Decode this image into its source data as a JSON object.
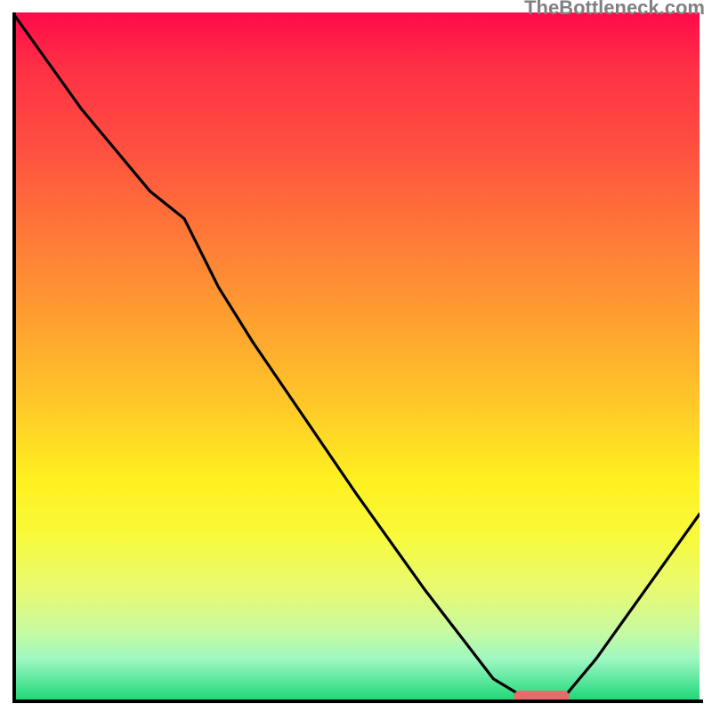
{
  "watermark": "TheBottleneck.com",
  "chart_data": {
    "type": "line",
    "x": [
      0,
      5,
      10,
      15,
      20,
      25,
      30,
      35,
      50,
      60,
      70,
      75,
      77,
      80,
      85,
      90,
      100
    ],
    "y": [
      100,
      93,
      86,
      80,
      74,
      70,
      60,
      52,
      30,
      16,
      3,
      0,
      0,
      0,
      6,
      13,
      27
    ],
    "xlabel": "",
    "ylabel": "",
    "title": "",
    "xlim": [
      0,
      100
    ],
    "ylim": [
      0,
      100
    ],
    "optimal_range": {
      "x_start": 73,
      "x_end": 81,
      "y": 0
    },
    "annotations": [],
    "gradient_stops": [
      {
        "pos": 0,
        "color": "#ff0a4a"
      },
      {
        "pos": 8,
        "color": "#ff3046"
      },
      {
        "pos": 20,
        "color": "#ff5040"
      },
      {
        "pos": 32,
        "color": "#ff7838"
      },
      {
        "pos": 45,
        "color": "#ffa030"
      },
      {
        "pos": 57,
        "color": "#ffc828"
      },
      {
        "pos": 68,
        "color": "#fff020"
      },
      {
        "pos": 76,
        "color": "#f8fa3a"
      },
      {
        "pos": 84,
        "color": "#e8fa72"
      },
      {
        "pos": 90,
        "color": "#c8faa0"
      },
      {
        "pos": 94,
        "color": "#a0f8c0"
      },
      {
        "pos": 97,
        "color": "#60e8a0"
      },
      {
        "pos": 100,
        "color": "#20d878"
      }
    ]
  }
}
